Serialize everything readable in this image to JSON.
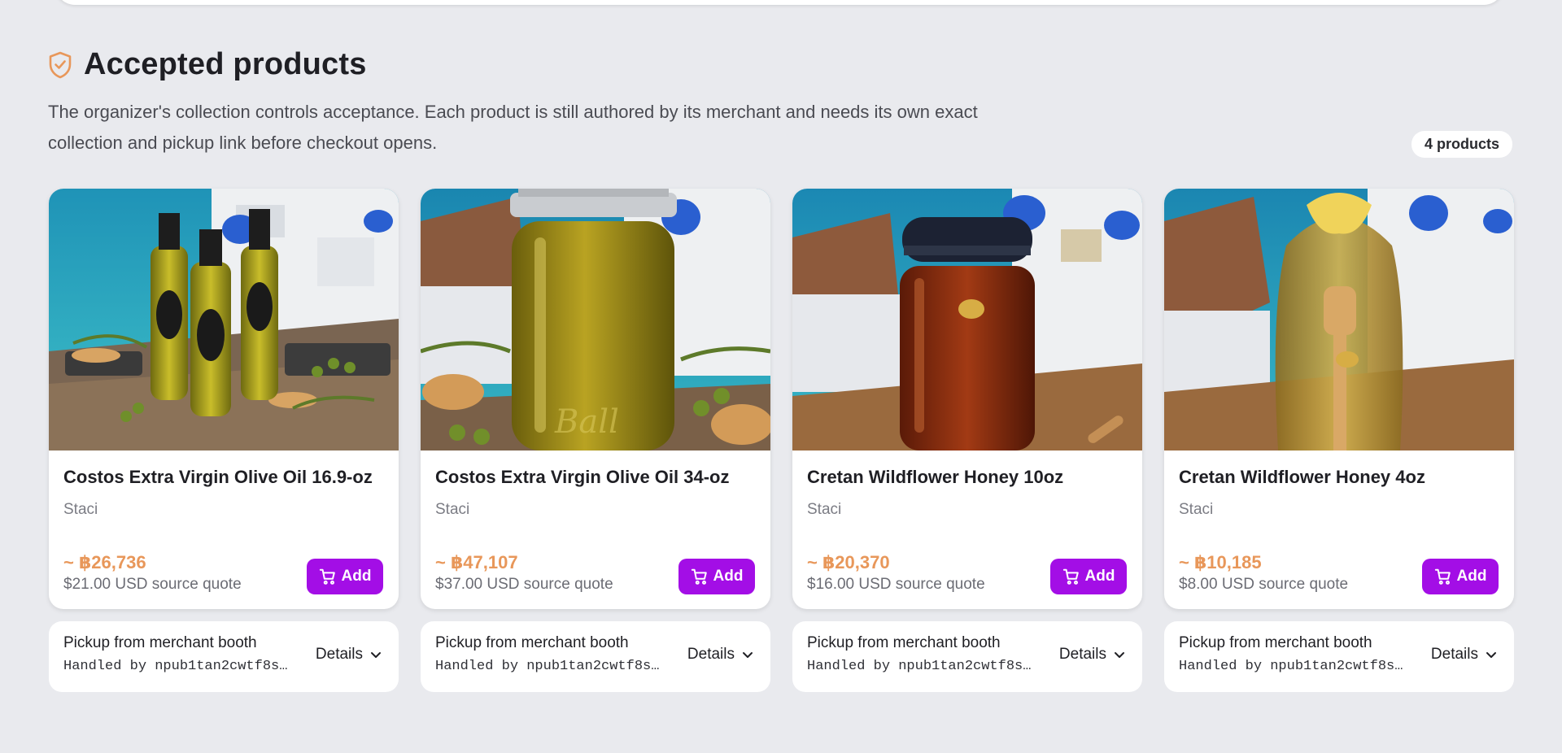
{
  "section": {
    "title": "Accepted products",
    "description": "The organizer's collection controls acceptance. Each product is still authored by its merchant and needs its own exact collection and pickup link before checkout opens.",
    "count_badge": "4 products",
    "icon": "shield-check-icon"
  },
  "colors": {
    "accent_purple": "#a30ee6",
    "price_orange": "#e8975a",
    "page_background": "#e9eaee"
  },
  "products": [
    {
      "name": "Costos Extra Virgin Olive Oil 16.9-oz",
      "merchant": "Staci",
      "price": "~ ฿26,736",
      "source_quote": "$21.00 USD source quote",
      "add_label": "Add",
      "pickup_title": "Pickup from merchant booth",
      "handler": "Handled by npub1tan2cwtf8s…",
      "details_label": "Details",
      "image": "olive-oil-bottles-santorini-photo"
    },
    {
      "name": "Costos Extra Virgin Olive Oil 34-oz",
      "merchant": "Staci",
      "price": "~ ฿47,107",
      "source_quote": "$37.00 USD source quote",
      "add_label": "Add",
      "pickup_title": "Pickup from merchant booth",
      "handler": "Handled by npub1tan2cwtf8s…",
      "details_label": "Details",
      "image": "olive-oil-jar-santorini-photo"
    },
    {
      "name": "Cretan Wildflower Honey 10oz",
      "merchant": "Staci",
      "price": "~ ฿20,370",
      "source_quote": "$16.00 USD source quote",
      "add_label": "Add",
      "pickup_title": "Pickup from merchant booth",
      "handler": "Handled by npub1tan2cwtf8s…",
      "details_label": "Details",
      "image": "honey-jar-santorini-photo"
    },
    {
      "name": "Cretan Wildflower Honey 4oz",
      "merchant": "Staci",
      "price": "~ ฿10,185",
      "source_quote": "$8.00 USD source quote",
      "add_label": "Add",
      "pickup_title": "Pickup from merchant booth",
      "handler": "Handled by npub1tan2cwtf8s…",
      "details_label": "Details",
      "image": "honey-gift-bag-santorini-photo"
    }
  ]
}
